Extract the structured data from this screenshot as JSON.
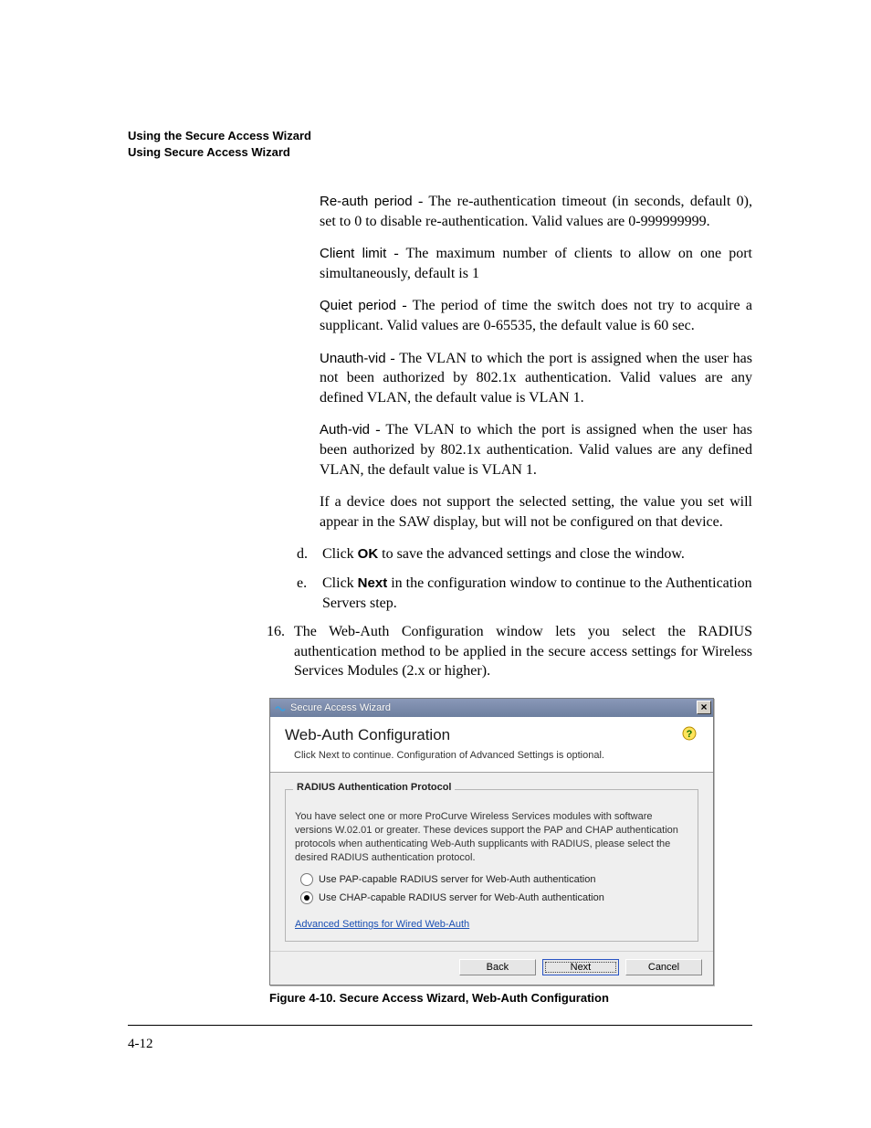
{
  "header": {
    "line1": "Using the Secure Access Wizard",
    "line2": "Using Secure Access Wizard"
  },
  "definitions": {
    "reauth": {
      "term": "Re-auth period",
      "text": " - The re-authentication timeout (in seconds, default 0), set to 0 to disable re-authentication. Valid values are 0-999999999."
    },
    "client": {
      "term": "Client limit",
      "text": " - The maximum number of clients to allow on one port simultaneously, default is 1"
    },
    "quiet": {
      "term": "Quiet period",
      "text": " - The period of time the switch does not try to acquire a supplicant. Valid values are 0-65535, the default value is 60 sec."
    },
    "unauth": {
      "term": "Unauth-vid",
      "text": " - The VLAN to which the port is assigned when the user has not been authorized by 802.1x authentication. Valid values are any defined VLAN, the default value is VLAN 1."
    },
    "auth": {
      "term": "Auth-vid",
      "text": " - The VLAN to which the port is assigned when the user has been authorized by 802.1x authentication. Valid values are any defined VLAN, the default value is VLAN 1."
    },
    "note": "If a device does not support the selected setting, the value you set will appear in the SAW display, but will not be configured on that device."
  },
  "sublist": {
    "d": {
      "marker": "d.",
      "pre": "Click ",
      "bold": "OK",
      "post": " to save the advanced settings and close the window."
    },
    "e": {
      "marker": "e.",
      "pre": "Click ",
      "bold": "Next",
      "post": " in the configuration window to continue to the Authentication Servers step."
    }
  },
  "step16": {
    "marker": "16.",
    "text": "The Web-Auth Configuration window lets you select the RADIUS authentication method to be applied in the secure access settings for Wireless Services Modules (2.x or higher)."
  },
  "wizard": {
    "title": "Secure Access Wizard",
    "heading": "Web-Auth Configuration",
    "sub": "Click Next to continue. Configuration of Advanced Settings is optional.",
    "legend": "RADIUS Authentication Protocol",
    "desc": "You have select one or more ProCurve Wireless Services modules with software versions W.02.01 or greater. These devices support the PAP and CHAP authentication protocols when authenticating Web-Auth supplicants with RADIUS, please select the desired RADIUS authentication protocol.",
    "radio_pap": "Use PAP-capable RADIUS server for Web-Auth authentication",
    "radio_chap": "Use CHAP-capable RADIUS server for Web-Auth authentication",
    "link": "Advanced Settings for Wired Web-Auth",
    "back": "Back",
    "next": "Next",
    "cancel": "Cancel",
    "close": "×"
  },
  "figure_caption": "Figure 4-10. Secure Access Wizard, Web-Auth Configuration",
  "page_number": "4-12"
}
